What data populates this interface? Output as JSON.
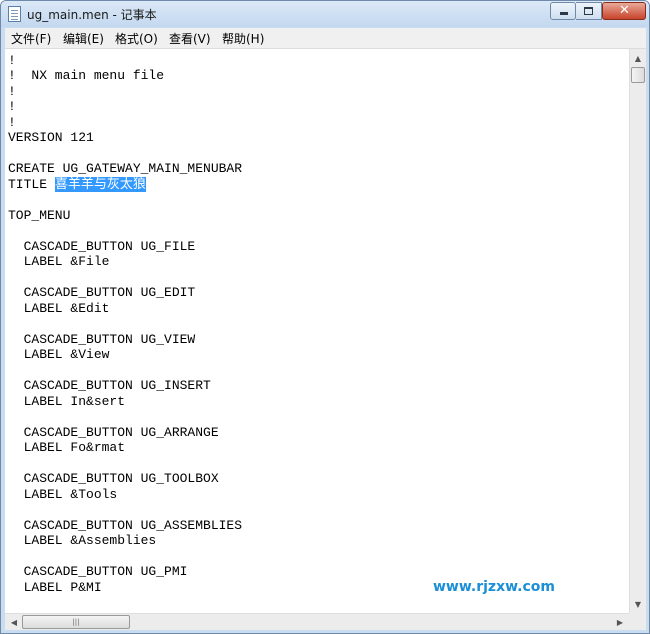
{
  "window": {
    "title": "ug_main.men - 记事本"
  },
  "menu": [
    {
      "label": "文件(F)"
    },
    {
      "label": "编辑(E)"
    },
    {
      "label": "格式(O)"
    },
    {
      "label": "查看(V)"
    },
    {
      "label": "帮助(H)"
    }
  ],
  "controls": {
    "close_glyph": "✕"
  },
  "editor": {
    "lines": [
      "!",
      "!  NX main menu file",
      "!",
      "!",
      "!",
      "VERSION 121",
      "",
      "CREATE UG_GATEWAY_MAIN_MENUBAR",
      "TITLE ",
      "",
      "TOP_MENU",
      "",
      "  CASCADE_BUTTON UG_FILE",
      "  LABEL &File",
      "",
      "  CASCADE_BUTTON UG_EDIT",
      "  LABEL &Edit",
      "",
      "  CASCADE_BUTTON UG_VIEW",
      "  LABEL &View",
      "",
      "  CASCADE_BUTTON UG_INSERT",
      "  LABEL In&sert",
      "",
      "  CASCADE_BUTTON UG_ARRANGE",
      "  LABEL Fo&rmat",
      "",
      "  CASCADE_BUTTON UG_TOOLBOX",
      "  LABEL &Tools",
      "",
      "  CASCADE_BUTTON UG_ASSEMBLIES",
      "  LABEL &Assemblies",
      "",
      "  CASCADE_BUTTON UG_PMI",
      "  LABEL P&MI"
    ],
    "selected_text": "喜羊羊与灰太狼"
  },
  "watermark": "www.rjzxw.com"
}
